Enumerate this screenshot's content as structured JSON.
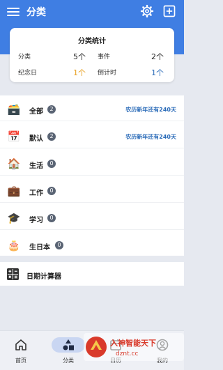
{
  "header": {
    "title": "分类"
  },
  "stats": {
    "title": "分类统计",
    "category_label": "分类",
    "category_value": "5个",
    "event_label": "事件",
    "event_value": "2个",
    "anniversary_label": "纪念日",
    "anniversary_value": "1个",
    "countdown_label": "倒计时",
    "countdown_value": "1个",
    "colors": {
      "anniversary": "#e8a020",
      "countdown": "#2a6bb8"
    }
  },
  "categories": [
    {
      "name": "全部",
      "count": "2",
      "info": "农历新年还有240天",
      "icon": "money-box-icon"
    },
    {
      "name": "默认",
      "count": "2",
      "info": "农历新年还有240天",
      "icon": "calendar-icon"
    },
    {
      "name": "生活",
      "count": "0",
      "info": "",
      "icon": "house-icon"
    },
    {
      "name": "工作",
      "count": "0",
      "info": "",
      "icon": "briefcase-icon"
    },
    {
      "name": "学习",
      "count": "0",
      "info": "",
      "icon": "graduation-cap-icon"
    },
    {
      "name": "生日本",
      "count": "0",
      "info": "",
      "icon": "birthday-cake-icon"
    }
  ],
  "tools": {
    "date_calculator": "日期计算器"
  },
  "nav": {
    "home": "首页",
    "category": "分类",
    "calendar": "日历",
    "mine": "我的"
  },
  "watermark": {
    "line1": "入神智能天下",
    "line2": "dznt.cc"
  },
  "accent": "#3f7ee3"
}
